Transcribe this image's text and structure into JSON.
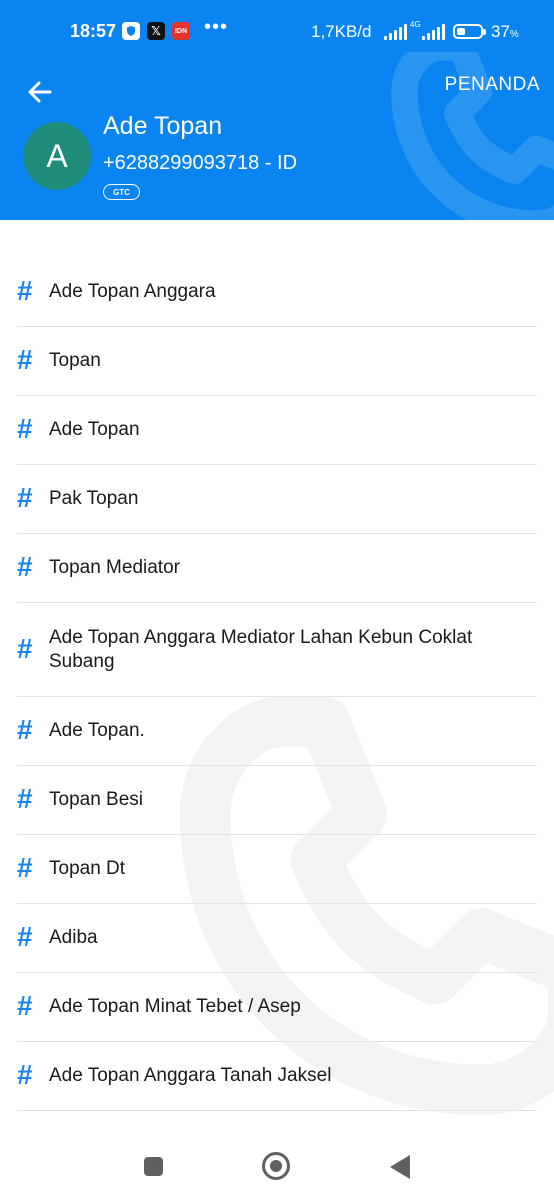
{
  "status_bar": {
    "time": "18:57",
    "x_glyph": "𝕏",
    "idn_label": "IDN",
    "dots": "•••",
    "speed": "1,7KB/d",
    "network_type": "4G",
    "battery_percent": "37",
    "battery_unit": "%",
    "battery_level": 0.37
  },
  "header": {
    "flag_label": "PENANDA",
    "avatar_initial": "A",
    "name": "Ade Topan",
    "number": "+6288299093718 - ID",
    "badge": "GTC",
    "color": "#0a84f0"
  },
  "tags": [
    "Ade Topan Anggara",
    "Topan",
    "Ade Topan",
    "Pak Topan",
    "Topan Mediator",
    "Ade Topan Anggara Mediator Lahan Kebun Coklat Subang",
    "Ade Topan.",
    "Topan Besi",
    "Topan Dt",
    "Adiba",
    "Ade Topan Minat Tebet / Asep",
    "Ade Topan Anggara Tanah Jaksel"
  ],
  "tag_symbol": "#",
  "icons": {
    "back": "arrow-left-icon",
    "phone_watermark": "phone-icon"
  }
}
